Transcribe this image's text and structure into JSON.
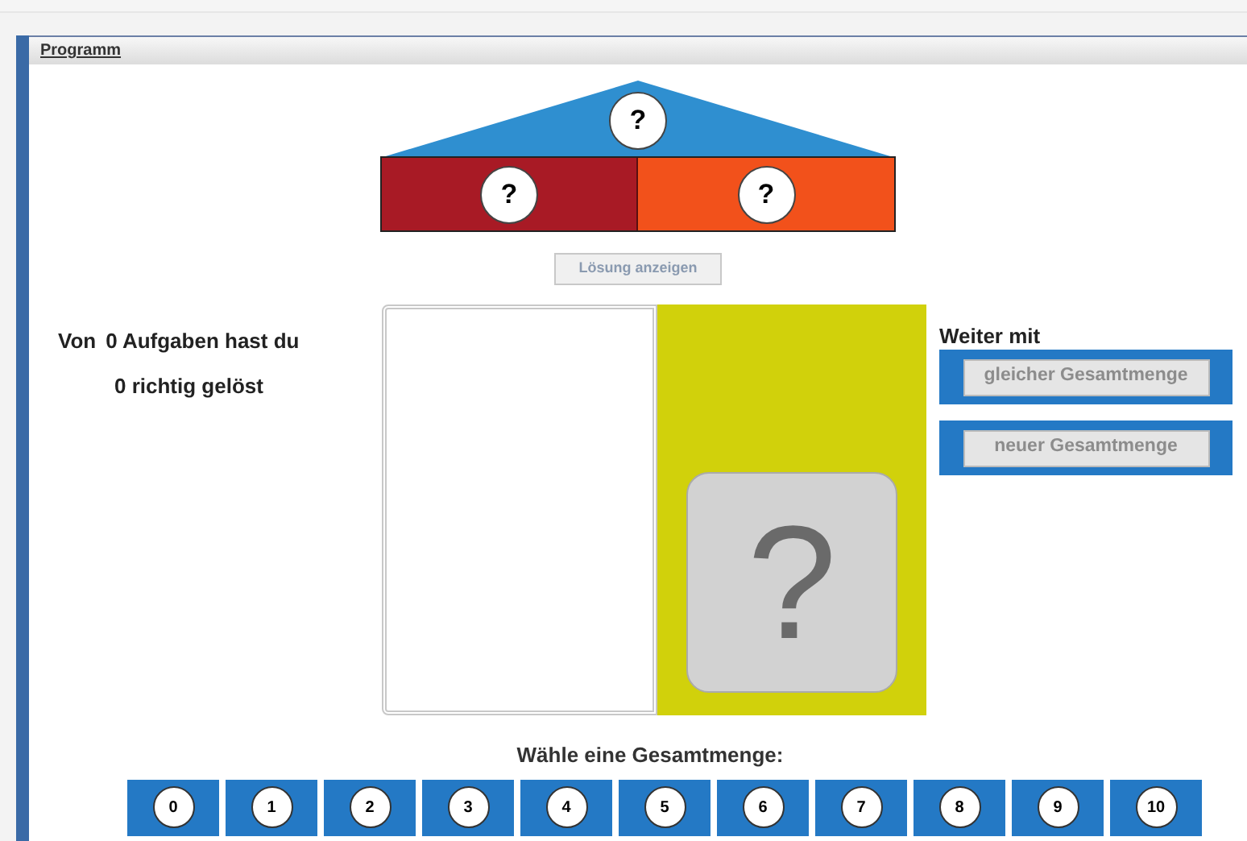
{
  "window": {
    "title": "Programm"
  },
  "house": {
    "roof": "?",
    "left": "?",
    "right": "?"
  },
  "solution_button": {
    "label": "Lösung anzeigen",
    "disabled": true
  },
  "score": {
    "line_1": [
      "Von",
      "0 Aufgaben hast du"
    ],
    "line_2": "0 richtig gelöst"
  },
  "card": {
    "symbol": "?"
  },
  "next": {
    "label": "Weiter mit",
    "buttons": [
      {
        "label": "gleicher Gesamtmenge",
        "disabled": true
      },
      {
        "label": "neuer Gesamtmenge",
        "disabled": true
      }
    ]
  },
  "choose": {
    "label": "Wähle eine Gesamtmenge:",
    "options": [
      "0",
      "1",
      "2",
      "3",
      "4",
      "5",
      "6",
      "7",
      "8",
      "9",
      "10"
    ]
  }
}
